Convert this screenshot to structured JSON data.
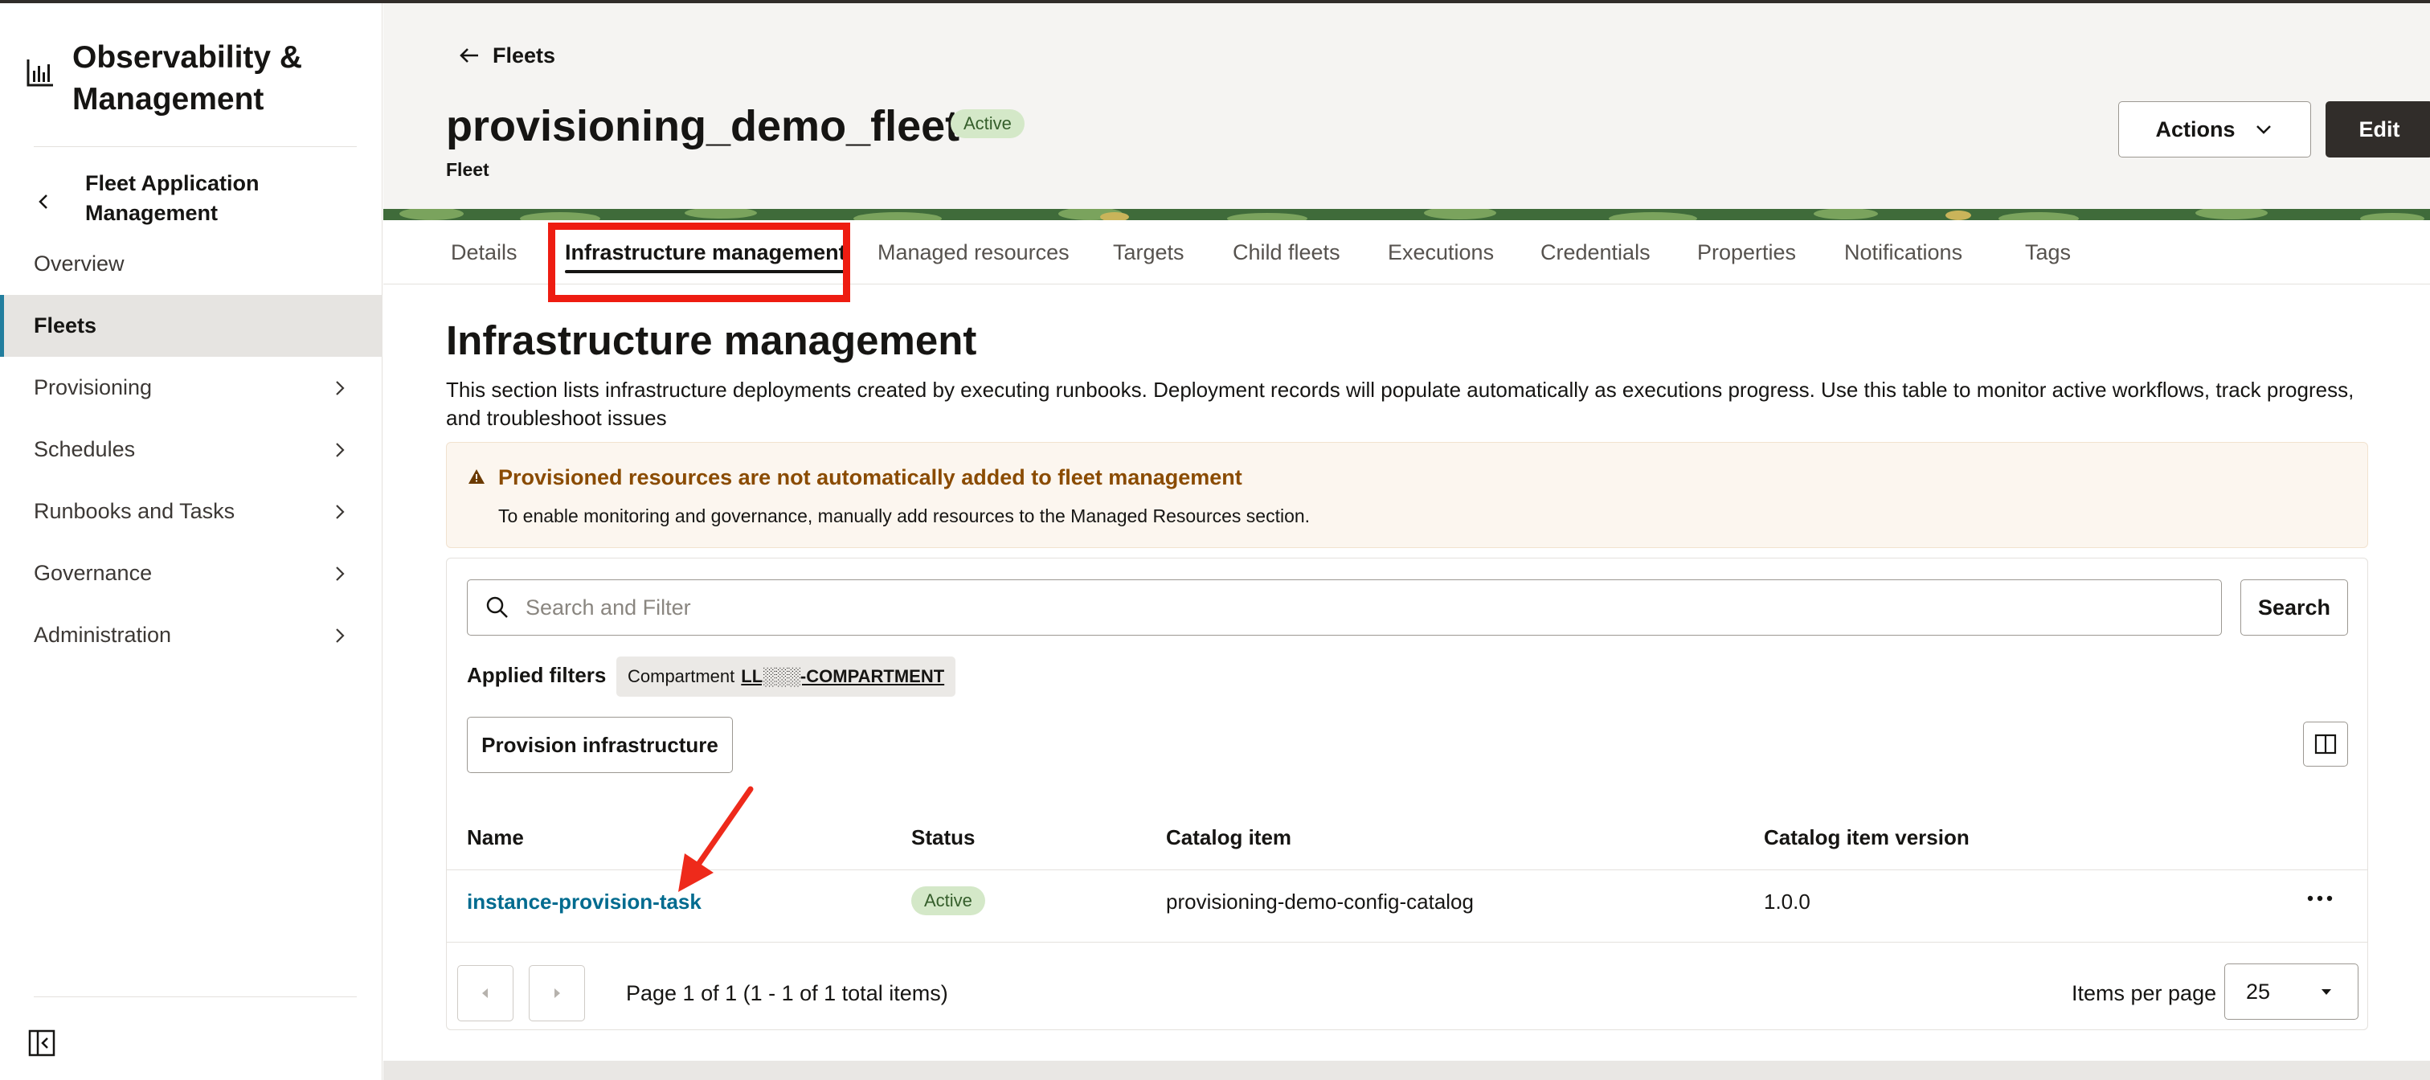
{
  "sidebar": {
    "brand_title": "Observability & Management",
    "back_title": "Fleet Application Management",
    "items": [
      {
        "label": "Overview"
      },
      {
        "label": "Fleets"
      },
      {
        "label": "Provisioning"
      },
      {
        "label": "Schedules"
      },
      {
        "label": "Runbooks and Tasks"
      },
      {
        "label": "Governance"
      },
      {
        "label": "Administration"
      }
    ]
  },
  "header": {
    "back_label": "Fleets",
    "title": "provisioning_demo_fleet",
    "status": "Active",
    "subtitle": "Fleet",
    "actions_label": "Actions",
    "edit_label": "Edit"
  },
  "tabs": [
    {
      "label": "Details"
    },
    {
      "label": "Infrastructure management"
    },
    {
      "label": "Managed resources"
    },
    {
      "label": "Targets"
    },
    {
      "label": "Child fleets"
    },
    {
      "label": "Executions"
    },
    {
      "label": "Credentials"
    },
    {
      "label": "Properties"
    },
    {
      "label": "Notifications"
    },
    {
      "label": "Tags"
    }
  ],
  "active_tab": "Infrastructure management",
  "main": {
    "title": "Infrastructure management",
    "description": "This section lists infrastructure deployments created by executing runbooks. Deployment records will populate automatically as executions progress. Use this table to monitor active workflows, track progress, and troubleshoot issues",
    "warning_title": "Provisioned resources are not automatically added to fleet management",
    "warning_text": "To enable monitoring and governance, manually add resources to the Managed Resources section.",
    "search_placeholder": "Search and Filter",
    "search_label": "Search",
    "applied_filters_label": "Applied filters",
    "filter_name": "Compartment",
    "filter_value": "LL░░░-COMPARTMENT",
    "provision_label": "Provision infrastructure"
  },
  "table": {
    "columns": [
      "Name",
      "Status",
      "Catalog item",
      "Catalog item version"
    ],
    "rows": [
      {
        "name": "instance-provision-task",
        "status": "Active",
        "catalog_item": "provisioning-demo-config-catalog",
        "version": "1.0.0"
      }
    ]
  },
  "pagination": {
    "info": "Page 1 of 1 (1 - 1 of 1 total items)",
    "items_per_page_label": "Items per page",
    "items_per_page": "25"
  },
  "colors": {
    "accent": "#227e9e",
    "link": "#006b8f",
    "highlight": "#ee1c11",
    "badge_bg": "#d4e8c8",
    "dark_button": "#312d2a",
    "warning_title": "#8a4b00"
  },
  "icons": {
    "brand": "bar-chart-icon",
    "back": "chevron-left-icon",
    "nav_expand": "chevron-right-icon",
    "collapse": "collapse-sidebar-icon",
    "search": "search-icon",
    "warning": "warning-icon",
    "columns": "column-layout-icon",
    "row_actions": "more-horizontal-icon"
  }
}
